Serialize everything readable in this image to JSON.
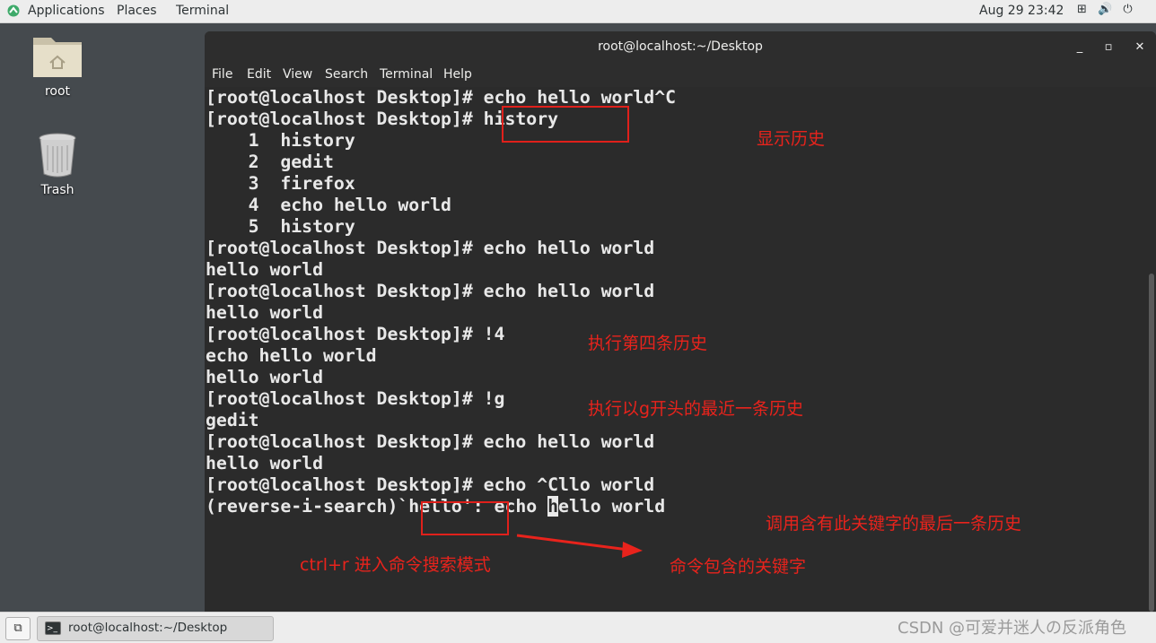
{
  "topbar": {
    "applications": "Applications",
    "places": "Places",
    "terminal": "Terminal",
    "clock": "Aug 29  23:42",
    "network_icon": "network-icon",
    "volume_icon": "volume-icon",
    "power_icon": "power-icon"
  },
  "desktop": {
    "icons": [
      {
        "label": "root",
        "icon": "home-folder-icon"
      },
      {
        "label": "Trash",
        "icon": "trash-icon"
      }
    ]
  },
  "window": {
    "title": "root@localhost:~/Desktop",
    "menu": [
      "File",
      "Edit",
      "View",
      "Search",
      "Terminal",
      "Help"
    ],
    "controls": {
      "minimize": "_",
      "maximize": "▫",
      "close": "✕"
    }
  },
  "terminal": {
    "lines": [
      "[root@localhost Desktop]# echo hello world^C",
      "[root@localhost Desktop]# history",
      "    1  history",
      "    2  gedit",
      "    3  firefox",
      "    4  echo hello world",
      "    5  history",
      "[root@localhost Desktop]# echo hello world",
      "hello world",
      "[root@localhost Desktop]# echo hello world",
      "hello world",
      "[root@localhost Desktop]# !4",
      "echo hello world",
      "hello world",
      "[root@localhost Desktop]# !g",
      "gedit",
      "[root@localhost Desktop]# echo hello world",
      "hello world",
      "[root@localhost Desktop]# echo ^Cllo world"
    ],
    "search_line": {
      "prefix": "(reverse-i-search)`hello': echo ",
      "cursor_char": "h",
      "suffix": "ello world"
    }
  },
  "annotations": {
    "show_history": "显示历史",
    "run_fourth": "执行第四条历史",
    "run_g": "执行以g开头的最近一条历史",
    "call_keyword": "调用含有此关键字的最后一条历史",
    "ctrl_r": "ctrl+r 进入命令搜索模式",
    "keyword": "命令包含的关键字",
    "accent_color": "#e8231c"
  },
  "taskbar": {
    "window_label": "root@localhost:~/Desktop",
    "watermark": "CSDN @可爱并迷人の反派角色"
  }
}
